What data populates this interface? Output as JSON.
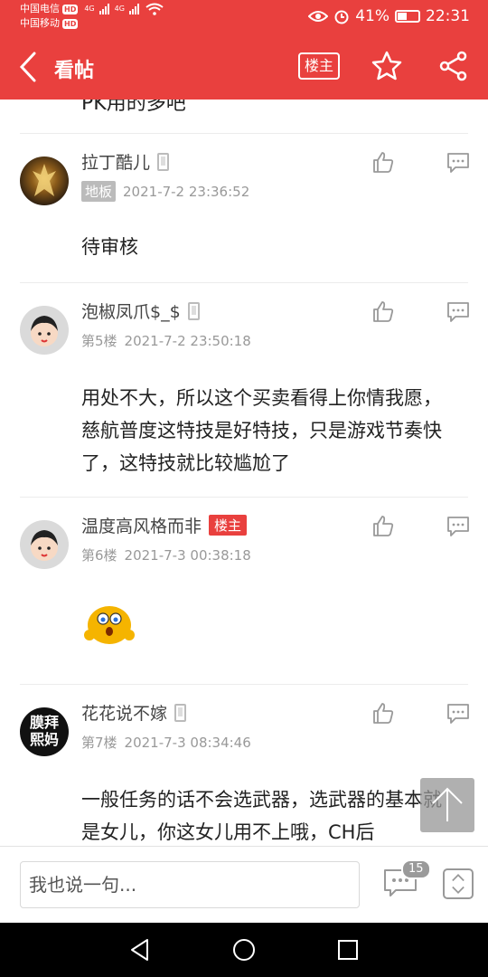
{
  "status_bar": {
    "carrier1": "中国电信",
    "carrier2": "中国移动",
    "hd_label": "HD",
    "net1": "4G",
    "net2": "4G",
    "battery": "41%",
    "time": "22:31"
  },
  "header": {
    "title": "看帖",
    "host_only_label": "楼主"
  },
  "previous_post_tail": "PK用的多吧",
  "posts": [
    {
      "name": "拉丁酷儿",
      "floor_tag": "地板",
      "time": "2021-7-2 23:36:52",
      "body": "待审核"
    },
    {
      "name": "泡椒凤爪$_$",
      "floor": "第5楼",
      "time": "2021-7-2 23:50:18",
      "body": "用处不大，所以这个买卖看得上你情我愿，慈航普度这特技是好特技，只是游戏节奏快了，这特技就比较尴尬了"
    },
    {
      "name": "温度高风格而非",
      "host_tag": "楼主",
      "floor": "第6楼",
      "time": "2021-7-3 00:38:18"
    },
    {
      "name": "花花说不嫁",
      "avatar_text": "膜拜\n熙妈",
      "floor": "第7楼",
      "time": "2021-7-3 08:34:46",
      "body": "一般任务的话不会选武器，选武器的基本就是女儿，你这女儿用不上哦，CH后"
    }
  ],
  "bottom_bar": {
    "input_placeholder": "我也说一句...",
    "comment_count": "15"
  },
  "colors": {
    "brand": "#e9403e"
  }
}
